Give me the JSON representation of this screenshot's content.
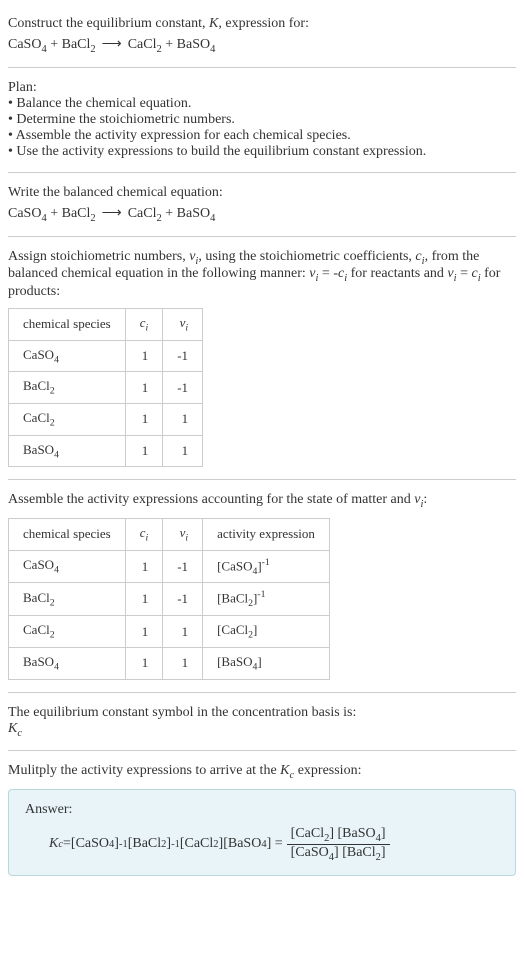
{
  "intro": {
    "line1": "Construct the equilibrium constant, ",
    "k": "K",
    "line1b": ", expression for:"
  },
  "reactant1": "CaSO",
  "reactant1_sub": "4",
  "reactant2": "BaCl",
  "reactant2_sub": "2",
  "product1": "CaCl",
  "product1_sub": "2",
  "product2": "BaSO",
  "product2_sub": "4",
  "plus": " + ",
  "arrow": "⟶",
  "plan": {
    "title": "Plan:",
    "items": [
      "Balance the chemical equation.",
      "Determine the stoichiometric numbers.",
      "Assemble the activity expression for each chemical species.",
      "Use the activity expressions to build the equilibrium constant expression."
    ]
  },
  "balanced_title": "Write the balanced chemical equation:",
  "assign": {
    "part1": "Assign stoichiometric numbers, ",
    "nu": "ν",
    "sub_i": "i",
    "part2": ", using the stoichiometric coefficients, ",
    "c": "c",
    "part3": ", from the balanced chemical equation in the following manner: ",
    "eq1a": "ν",
    "eq1b": " = -",
    "eq1c": "c",
    "part4": " for reactants and ",
    "eq2a": "ν",
    "eq2b": " = ",
    "eq2c": "c",
    "part5": " for products:"
  },
  "table1": {
    "h1": "chemical species",
    "h2": "c",
    "h2sub": "i",
    "h3": "ν",
    "h3sub": "i",
    "rows": [
      {
        "sp": "CaSO",
        "spsub": "4",
        "c": "1",
        "v": "-1"
      },
      {
        "sp": "BaCl",
        "spsub": "2",
        "c": "1",
        "v": "-1"
      },
      {
        "sp": "CaCl",
        "spsub": "2",
        "c": "1",
        "v": "1"
      },
      {
        "sp": "BaSO",
        "spsub": "4",
        "c": "1",
        "v": "1"
      }
    ]
  },
  "assemble": {
    "part1": "Assemble the activity expressions accounting for the state of matter and ",
    "nu": "ν",
    "sub_i": "i",
    "part2": ":"
  },
  "table2": {
    "h1": "chemical species",
    "h2": "c",
    "h2sub": "i",
    "h3": "ν",
    "h3sub": "i",
    "h4": "activity expression",
    "rows": [
      {
        "sp": "CaSO",
        "spsub": "4",
        "c": "1",
        "v": "-1",
        "act": "[CaSO",
        "actsub": "4",
        "actend": "]",
        "exp": "-1"
      },
      {
        "sp": "BaCl",
        "spsub": "2",
        "c": "1",
        "v": "-1",
        "act": "[BaCl",
        "actsub": "2",
        "actend": "]",
        "exp": "-1"
      },
      {
        "sp": "CaCl",
        "spsub": "2",
        "c": "1",
        "v": "1",
        "act": "[CaCl",
        "actsub": "2",
        "actend": "]",
        "exp": ""
      },
      {
        "sp": "BaSO",
        "spsub": "4",
        "c": "1",
        "v": "1",
        "act": "[BaSO",
        "actsub": "4",
        "actend": "]",
        "exp": ""
      }
    ]
  },
  "eqconst": {
    "line1": "The equilibrium constant symbol in the concentration basis is:",
    "k": "K",
    "ksub": "c"
  },
  "multiply": {
    "part1": "Mulitply the activity expressions to arrive at the ",
    "k": "K",
    "ksub": "c",
    "part2": " expression:"
  },
  "answer": {
    "label": "Answer:",
    "k": "K",
    "ksub": "c",
    "eq": " = ",
    "t1a": "[CaSO",
    "t1sub": "4",
    "t1b": "]",
    "t1exp": "-1",
    "t2a": " [BaCl",
    "t2sub": "2",
    "t2b": "]",
    "t2exp": "-1",
    "t3a": " [CaCl",
    "t3sub": "2",
    "t3b": "]",
    "t4a": " [BaSO",
    "t4sub": "4",
    "t4b": "] = ",
    "num1a": "[CaCl",
    "num1sub": "2",
    "num1b": "] [BaSO",
    "num2sub": "4",
    "num2b": "]",
    "den1a": "[CaSO",
    "den1sub": "4",
    "den1b": "] [BaCl",
    "den2sub": "2",
    "den2b": "]"
  }
}
